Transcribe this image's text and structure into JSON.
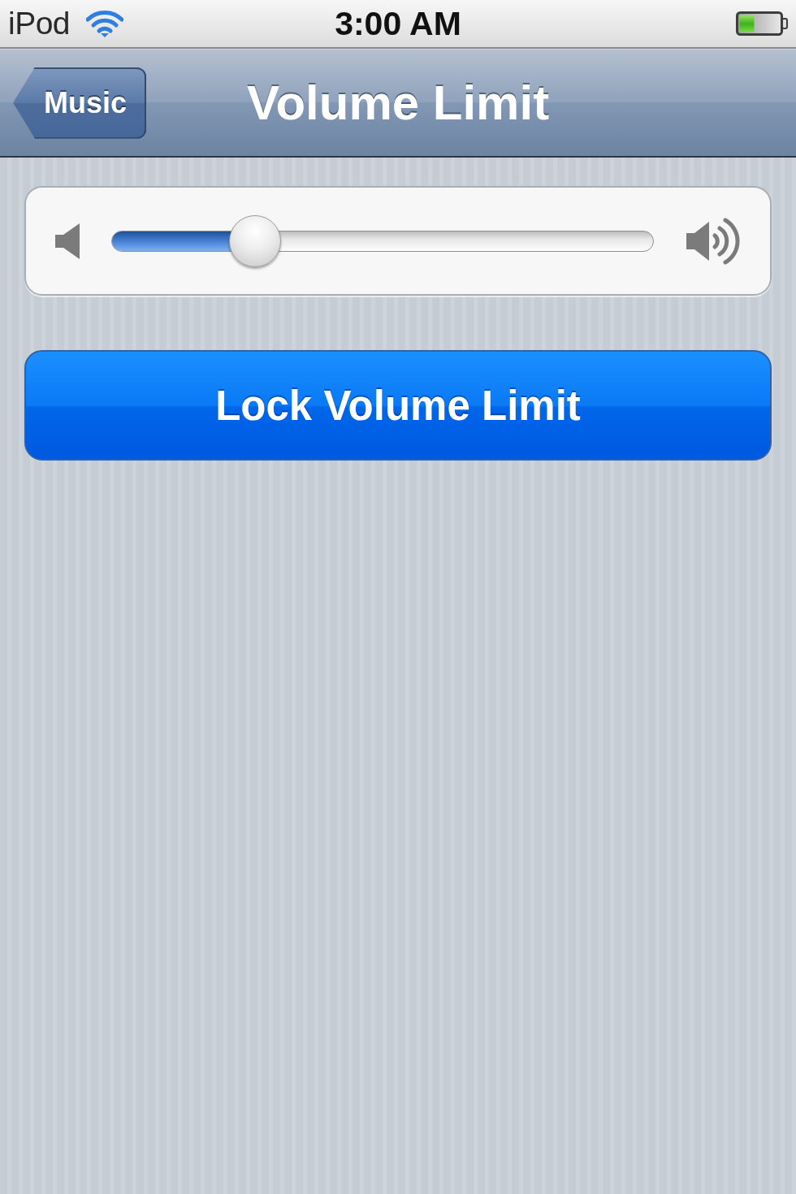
{
  "status_bar": {
    "carrier": "iPod",
    "time": "3:00 AM"
  },
  "nav_bar": {
    "back_button": "Music",
    "title": "Volume Limit"
  },
  "volume_slider": {
    "level": 0.24
  },
  "lock_button": {
    "label": "Lock Volume Limit"
  }
}
